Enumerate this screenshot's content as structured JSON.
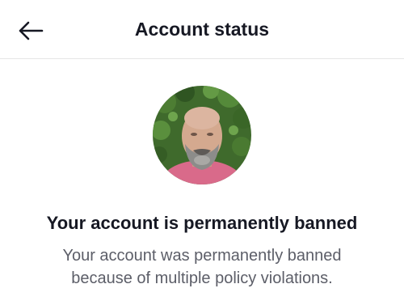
{
  "header": {
    "back_icon": "arrow-left-icon",
    "title": "Account status"
  },
  "profile": {
    "avatar_description": "profile-photo"
  },
  "status": {
    "headline": "Your account is permanently banned",
    "message": "Your account was permanently banned because of multiple policy violations."
  },
  "colors": {
    "text_primary": "#161823",
    "text_secondary": "#5c5e68",
    "divider": "#e6e6e6",
    "background": "#ffffff"
  }
}
